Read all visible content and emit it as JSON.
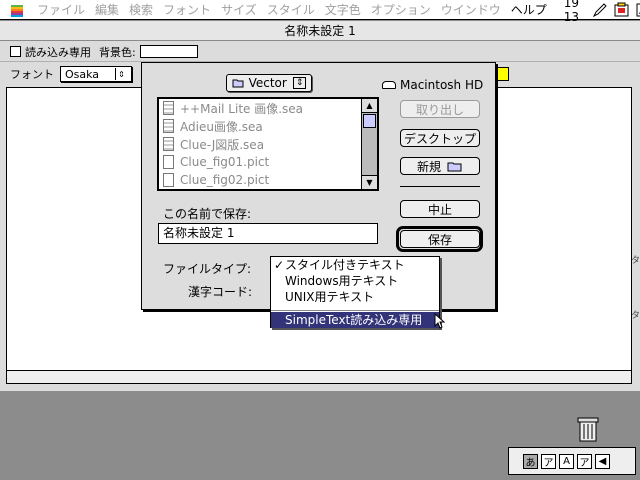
{
  "menubar": {
    "items": [
      "ファイル",
      "編集",
      "検索",
      "フォント",
      "サイズ",
      "スタイル",
      "文字色",
      "オプション",
      "ウインドウ",
      "ヘルプ"
    ],
    "active_items": [
      9
    ],
    "clock": "19 13",
    "icons": [
      "apple-icon",
      "pencil-icon",
      "application-icon",
      "language-icon"
    ]
  },
  "document": {
    "title": "名称未設定 1",
    "readonly_label": "読み込み専用",
    "bgcolor_label": "背景色:",
    "font_label": "フォント",
    "font_value": "Osaka",
    "side_marks": [
      "タ",
      "タ"
    ]
  },
  "dialog": {
    "folder_name": "Vector",
    "disk_name": "Macintosh HD",
    "files": [
      {
        "name": "++Mail Lite 画像.sea",
        "kind": "archive"
      },
      {
        "name": "Adieu画像.sea",
        "kind": "archive"
      },
      {
        "name": "Clue-J図版.sea",
        "kind": "archive"
      },
      {
        "name": "Clue_fig01.pict",
        "kind": "pict"
      },
      {
        "name": "Clue_fig02.pict",
        "kind": "pict"
      }
    ],
    "eject_label": "取り出し",
    "desktop_label": "デスクトップ",
    "newfolder_label": "新規",
    "cancel_label": "中止",
    "save_label": "保存",
    "save_as_label": "この名前で保存:",
    "filename_value": "名称未設定 1",
    "filetype_label": "ファイルタイプ:",
    "kanji_label": "漢字コード:"
  },
  "filetype_menu": {
    "options": [
      "スタイル付きテキスト",
      "Windows用テキスト",
      "UNIX用テキスト"
    ],
    "checked_index": 0,
    "extra_option": "SimpleText読み込み専用",
    "highlighted": "SimpleText読み込み専用"
  },
  "palette": {
    "buttons": [
      "あ",
      "ア",
      "A",
      "ア"
    ]
  },
  "colors": {
    "menu_highlight": "#33337a",
    "background_tag": "#ffff00"
  }
}
